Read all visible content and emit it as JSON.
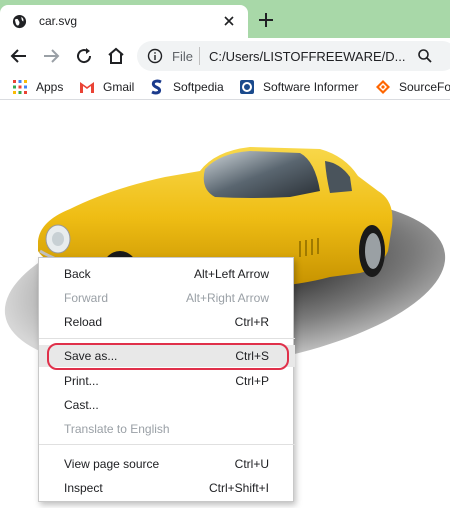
{
  "tab": {
    "title": "car.svg"
  },
  "toolbar": {
    "scheme_label": "File",
    "url": "C:/Users/LISTOFFREEWARE/D..."
  },
  "bookmarks": [
    {
      "label": "Apps",
      "icon": "apps-grid-icon"
    },
    {
      "label": "Gmail",
      "icon": "gmail-icon"
    },
    {
      "label": "Softpedia",
      "icon": "softpedia-icon"
    },
    {
      "label": "Software Informer",
      "icon": "software-informer-icon"
    },
    {
      "label": "SourceFo",
      "icon": "sourceforge-icon"
    }
  ],
  "menu": {
    "items": [
      {
        "label": "Back",
        "shortcut": "Alt+Left Arrow",
        "enabled": true
      },
      {
        "label": "Forward",
        "shortcut": "Alt+Right Arrow",
        "enabled": false
      },
      {
        "label": "Reload",
        "shortcut": "Ctrl+R",
        "enabled": true
      },
      {
        "label": "Save as...",
        "shortcut": "Ctrl+S",
        "enabled": true,
        "highlighted": true
      },
      {
        "label": "Print...",
        "shortcut": "Ctrl+P",
        "enabled": true
      },
      {
        "label": "Cast...",
        "shortcut": "",
        "enabled": true
      },
      {
        "label": "Translate to English",
        "shortcut": "",
        "enabled": false
      },
      {
        "label": "View page source",
        "shortcut": "Ctrl+U",
        "enabled": true
      },
      {
        "label": "Inspect",
        "shortcut": "Ctrl+Shift+I",
        "enabled": true
      }
    ]
  },
  "colors": {
    "tabstrip": "#a8d8a8",
    "highlight_ring": "#e0304a",
    "car_body": "#f2c21a"
  }
}
